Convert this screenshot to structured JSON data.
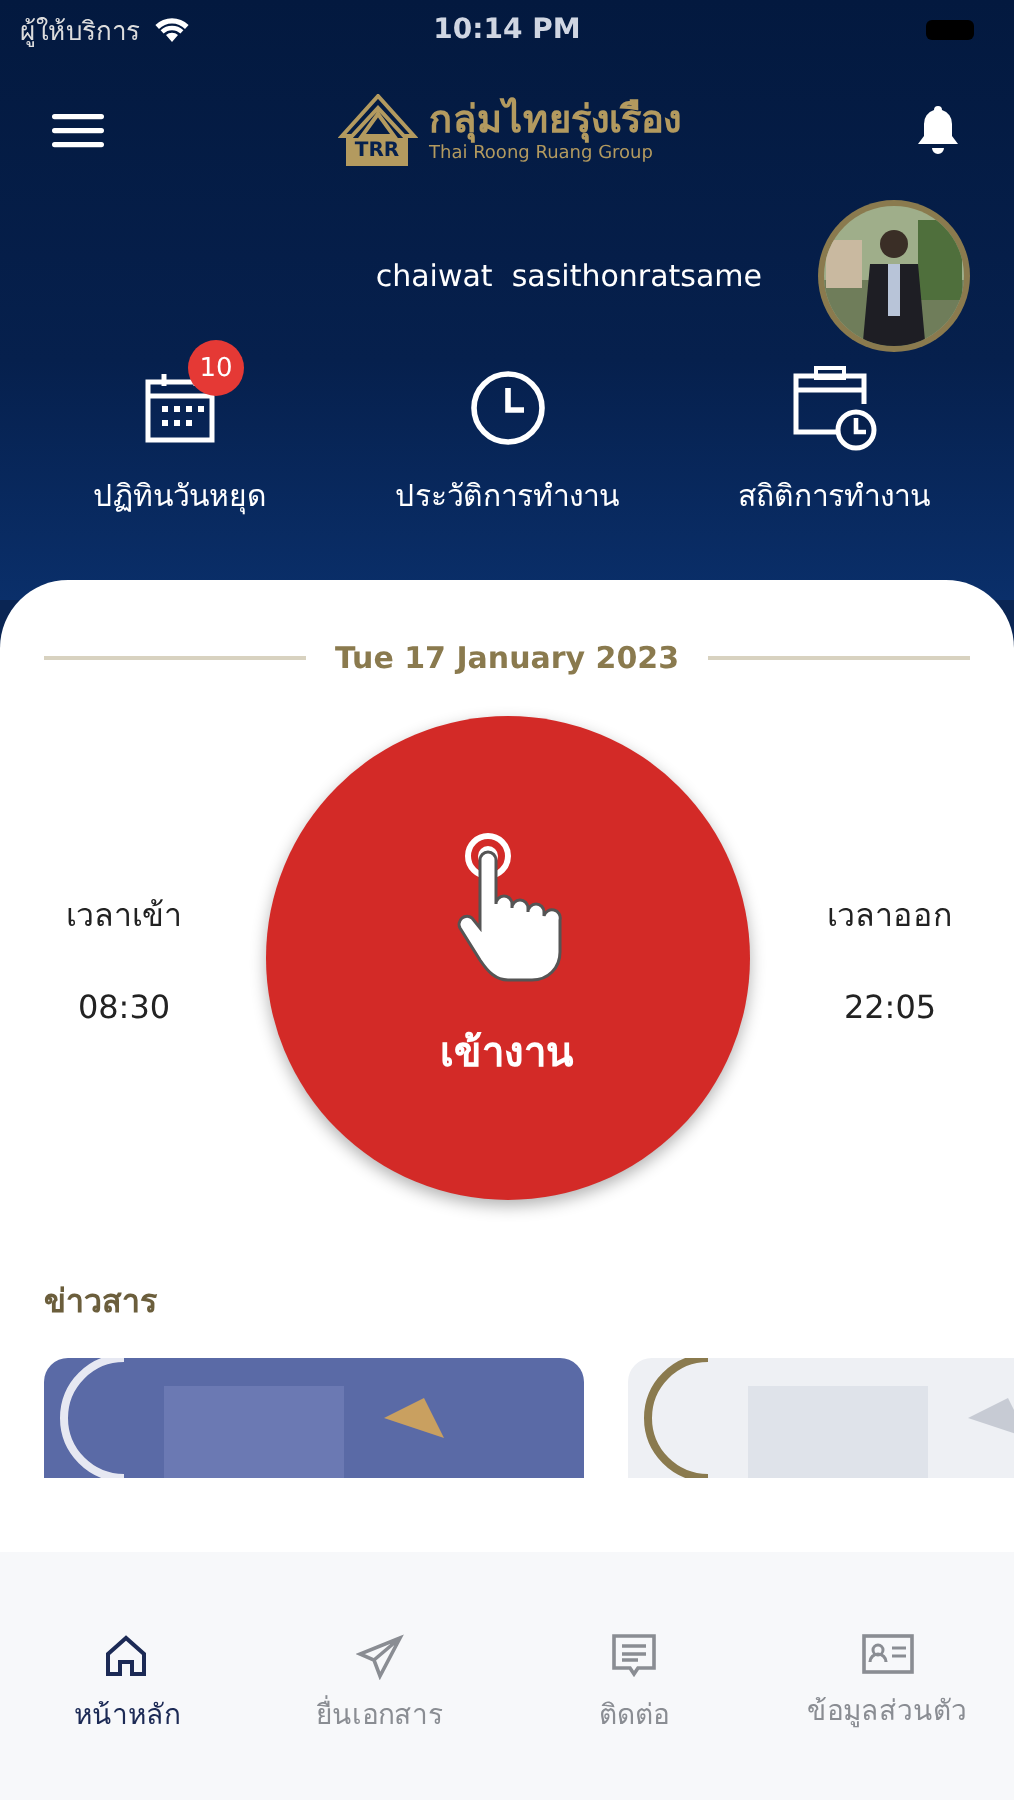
{
  "status_bar": {
    "carrier": "ผู้ให้บริการ",
    "time": "10:14 PM"
  },
  "header": {
    "logo_mark": "TRR",
    "logo_title": "กลุ่มไทยรุ่งเรือง",
    "logo_subtitle": "Thai Roong Ruang Group"
  },
  "user": {
    "name": "chaiwat  sasithonratsame"
  },
  "quick_actions": [
    {
      "kind": "calendar",
      "label": "ปฏิทินวันหยุด",
      "badge": "10"
    },
    {
      "kind": "clock",
      "label": "ประวัติการทำงาน"
    },
    {
      "kind": "stats",
      "label": "สถิติการทำงาน"
    }
  ],
  "date": "Tue 17 January 2023",
  "check_in": {
    "label": "เวลาเข้า",
    "time": "08:30"
  },
  "check_out": {
    "label": "เวลาออก",
    "time": "22:05"
  },
  "clock_button": {
    "label": "เข้างาน"
  },
  "news": {
    "title": "ข่าวสาร"
  },
  "bottom_nav": [
    {
      "kind": "home",
      "label": "หน้าหลัก",
      "selected": true
    },
    {
      "kind": "send",
      "label": "ยื่นเอกสาร",
      "selected": false
    },
    {
      "kind": "chat",
      "label": "ติดต่อ",
      "selected": false
    },
    {
      "kind": "profile",
      "label": "ข้อมูลส่วนตัว",
      "selected": false
    }
  ]
}
